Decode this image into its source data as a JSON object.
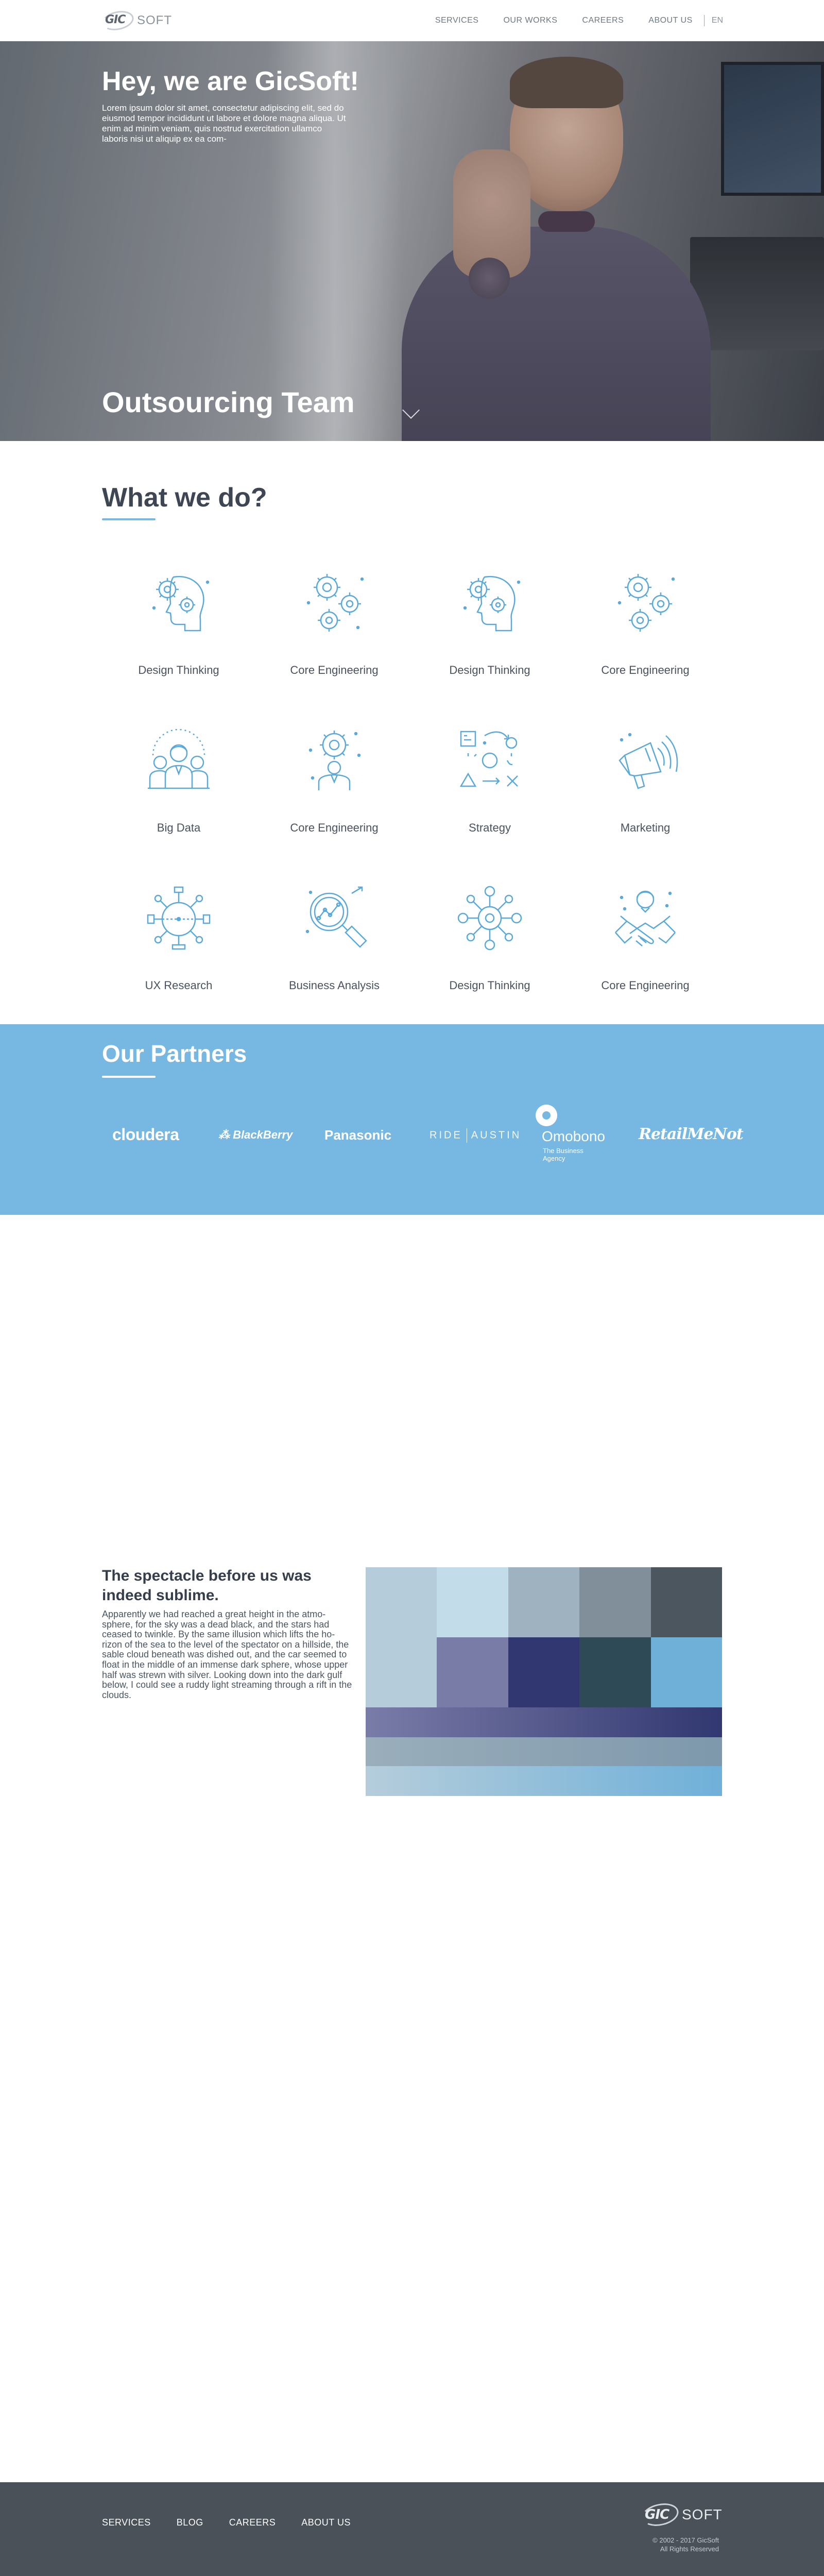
{
  "nav": {
    "logo_gic": "GIC",
    "logo_soft": "SOFT",
    "links": [
      "SERVICES",
      "OUR WORKS",
      "CAREERS",
      "ABOUT US"
    ],
    "lang": "EN"
  },
  "hero": {
    "title": "Hey, we are GicSoft!",
    "text": "Lorem ipsum dolor sit amet, consectetur adipiscing elit, sed do eiusmod tempor incididunt ut labore et dolore magna aliqua. Ut enim ad minim veniam, quis nostrud exercitation ullamco laboris nisi ut aliquip ex ea com-",
    "bottom_title": "Outsourcing Team"
  },
  "what_we_do": {
    "title": "What we do?",
    "items": [
      {
        "label": "Design Thinking",
        "icon": "head-gears-icon"
      },
      {
        "label": "Core Engineering",
        "icon": "gears-icon"
      },
      {
        "label": "Design Thinking",
        "icon": "head-gears-icon"
      },
      {
        "label": "Core Engineering",
        "icon": "gears-icon"
      },
      {
        "label": "Big Data",
        "icon": "team-icon"
      },
      {
        "label": "Core Engineering",
        "icon": "person-gear-icon"
      },
      {
        "label": "Strategy",
        "icon": "strategy-icon"
      },
      {
        "label": "Marketing",
        "icon": "megaphone-icon"
      },
      {
        "label": "UX Research",
        "icon": "network-globe-icon"
      },
      {
        "label": "Business Analysis",
        "icon": "magnifier-chart-icon"
      },
      {
        "label": "Design Thinking",
        "icon": "connections-icon"
      },
      {
        "label": "Core Engineering",
        "icon": "handshake-icon"
      }
    ]
  },
  "partners": {
    "title": "Our Partners",
    "logos": {
      "cloudera": "cloudera",
      "blackberry": "BlackBerry",
      "panasonic": "Panasonic",
      "ride_a": "RIDE",
      "ride_b": "AUSTIN",
      "omobono": "Omobono",
      "omobono_sub": "The Business Agency",
      "retailmenot": "RetailMeNot"
    }
  },
  "article": {
    "title": "The spectacle before us was indeed sublime.",
    "body": "Apparently we had reached a great height in the atmo-sphere, for the sky was a dead black, and the stars had ceased to twinkle. By the same illusion which lifts the ho-rizon of the sea to the level of the spectator on a hillside, the sable cloud beneath was dished out, and the car seemed to float in the middle of an immense dark sphere, whose upper half was strewn with silver. Looking down into the dark gulf below, I could see a ruddy light streaming through a rift in the clouds."
  },
  "palette": {
    "row1": [
      "#b5cddb",
      "#c2dcea",
      "#9fb2c0",
      "#808f9a",
      "#4c565e"
    ],
    "row2": [
      "#b5cddb",
      "#7a7ca8",
      "#313770",
      "#2e4a57",
      "#6fb0d9"
    ],
    "band1_from": "#7a7ca8",
    "band1_to": "#313770",
    "band2_from": "#9aaebb",
    "band2_to": "#7e98ac",
    "band3_from": "#b5cddb",
    "band3_to": "#6fb0d9"
  },
  "footer": {
    "links": [
      "SERVICES",
      "BLOG",
      "CAREERS",
      "ABOUT US"
    ],
    "logo_gic": "GIC",
    "logo_soft": "SOFT",
    "copyright_1": "© 2002 - 2017  GicSoft",
    "copyright_2": "All Rights Reserved"
  },
  "colors": {
    "accent": "#76b8e0",
    "partners_bg": "#77b8e2",
    "footer_bg": "#4a5159",
    "icon": "#5aa9d8"
  }
}
